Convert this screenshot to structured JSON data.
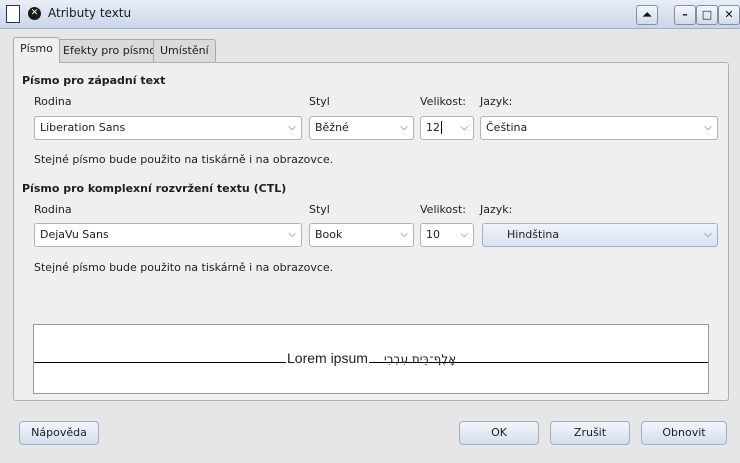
{
  "window": {
    "title": "Atributy textu",
    "buttons": {
      "help_symbol": "⏶",
      "minimize": "–",
      "maximize": "□",
      "close": "✕"
    }
  },
  "tabs": [
    {
      "label": "Písmo",
      "active": true
    },
    {
      "label": "Efekty pro písmo",
      "active": false
    },
    {
      "label": "Umístění",
      "active": false
    }
  ],
  "western": {
    "section_title": "Písmo pro západní text",
    "family_label": "Rodina",
    "style_label": "Styl",
    "size_label": "Velikost:",
    "lang_label": "Jazyk:",
    "family_value": "Liberation Sans",
    "style_value": "Běžné",
    "size_value": "12",
    "lang_value": "Čeština",
    "info": "Stejné písmo bude použito na tiskárně i na obrazovce."
  },
  "ctl": {
    "section_title": "Písmo pro komplexní rozvržení textu (CTL)",
    "family_label": "Rodina",
    "style_label": "Styl",
    "size_label": "Velikost:",
    "lang_label": "Jazyk:",
    "family_value": "DejaVu Sans",
    "style_value": "Book",
    "size_value": "10",
    "lang_value": "Hindština",
    "info": "Stejné písmo bude použito na tiskárně i na obrazovce."
  },
  "preview": {
    "latin_text": "Lorem ipsum",
    "ctl_text": "אָלֶף־בֵּית עִבְרִי"
  },
  "footer": {
    "help": "Nápověda",
    "ok": "OK",
    "cancel": "Zrušit",
    "reset": "Obnovit"
  }
}
